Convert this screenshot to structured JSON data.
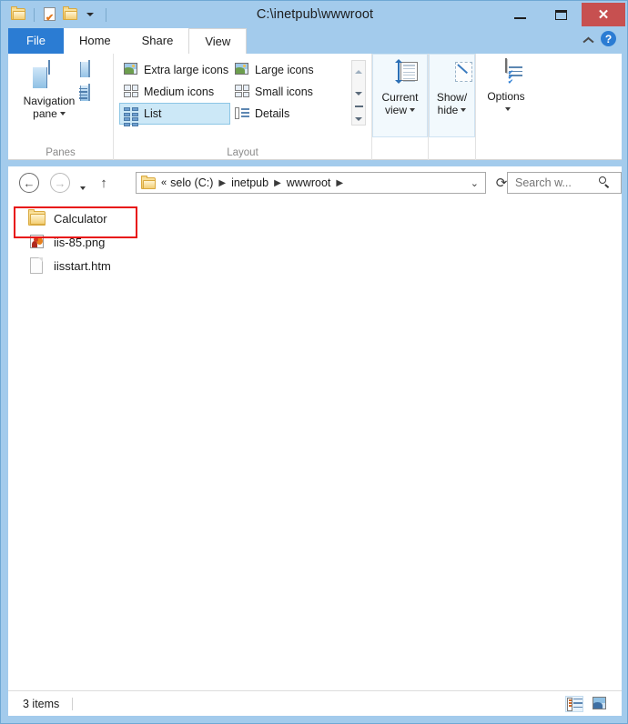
{
  "window": {
    "title": "C:\\inetpub\\wwwroot",
    "accent_blue": "#a3cbec",
    "file_tab_blue": "#2b7cd3",
    "close_red": "#c75050",
    "highlight_red": "#e81313"
  },
  "quick_access": {
    "items": [
      {
        "label": "Explorer",
        "icon": "folder-icon"
      },
      {
        "label": "Properties",
        "icon": "properties-icon"
      },
      {
        "label": "New folder",
        "icon": "new-folder-icon"
      },
      {
        "label": "Customize Quick Access Toolbar",
        "icon": "chevron-down-icon"
      }
    ]
  },
  "window_controls": {
    "minimize": "Minimize",
    "maximize": "Maximize",
    "close": "✕"
  },
  "ribbon": {
    "tabs": [
      {
        "label": "File",
        "state": "file"
      },
      {
        "label": "Home",
        "state": "inactive"
      },
      {
        "label": "Share",
        "state": "inactive"
      },
      {
        "label": "View",
        "state": "active"
      }
    ],
    "collapse_label": "Minimize the Ribbon",
    "help_label": "?",
    "groups": [
      {
        "name": "Panes",
        "label": "Panes",
        "big_button": {
          "label_line1": "Navigation",
          "label_line2": "pane",
          "icon": "navigation-pane-icon"
        },
        "small_buttons": [
          {
            "label": "Preview pane",
            "icon": "preview-pane-icon"
          },
          {
            "label": "Details pane",
            "icon": "details-pane-icon"
          }
        ]
      },
      {
        "name": "Layout",
        "label": "Layout",
        "gallery": [
          {
            "label": "Extra large icons",
            "icon": "extra-large-icons-icon",
            "selected": false
          },
          {
            "label": "Large icons",
            "icon": "large-icons-icon",
            "selected": false
          },
          {
            "label": "Medium icons",
            "icon": "medium-icons-icon",
            "selected": false
          },
          {
            "label": "Small icons",
            "icon": "small-icons-icon",
            "selected": false
          },
          {
            "label": "List",
            "icon": "list-view-icon",
            "selected": true
          },
          {
            "label": "Details",
            "icon": "details-view-icon",
            "selected": false
          }
        ],
        "scroll": {
          "up": "Scroll up",
          "down": "Scroll down",
          "more": "More"
        }
      },
      {
        "name": "Current view",
        "label": "",
        "button": {
          "label_line1": "Current",
          "label_line2": "view",
          "icon": "current-view-icon"
        }
      },
      {
        "name": "Show/hide",
        "label": "",
        "button": {
          "label_line1": "Show/",
          "label_line2": "hide",
          "icon": "show-hide-icon"
        }
      },
      {
        "name": "Options",
        "label": "",
        "button": {
          "label_line1": "Options",
          "label_line2": "",
          "icon": "options-icon"
        }
      }
    ]
  },
  "address_bar": {
    "back": "←",
    "forward": "→",
    "recent": "▾",
    "up": "↑",
    "refresh": "⟳",
    "folder_icon": "folder-icon",
    "overflow": "«",
    "crumbs": [
      "selo (C:)",
      "inetpub",
      "wwwroot"
    ],
    "crumb_separator": "▶",
    "dropdown": "⌄",
    "search": {
      "placeholder": "Search w...",
      "value": "",
      "icon": "search-icon"
    }
  },
  "file_list": {
    "items": [
      {
        "name": "Calculator",
        "type": "folder",
        "icon": "folder-icon",
        "highlighted": true
      },
      {
        "name": "iis-85.png",
        "type": "image",
        "icon": "image-file-icon",
        "highlighted": false
      },
      {
        "name": "iisstart.htm",
        "type": "document",
        "icon": "document-file-icon",
        "highlighted": false
      }
    ]
  },
  "status_bar": {
    "count_text": "3 items",
    "views": [
      {
        "label": "Details view",
        "icon": "details-view-icon",
        "active": true
      },
      {
        "label": "Large icons view",
        "icon": "large-icons-view-icon",
        "active": false
      }
    ]
  }
}
